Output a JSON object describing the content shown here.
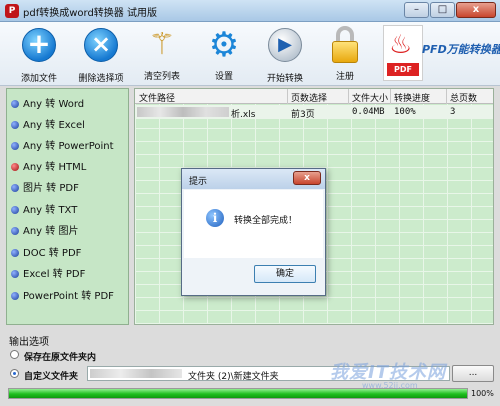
{
  "window": {
    "title": "pdf转换成word转换器 试用版",
    "icon_name": "app-icon",
    "minimize": "–",
    "maximize": "□",
    "close": "x"
  },
  "toolbar": {
    "add_file": "添加文件",
    "remove_selected": "删除选择项",
    "clear_list": "清空列表",
    "settings": "设置",
    "start_convert": "开始转换",
    "register": "注册",
    "pdf_logo_text": "PDF",
    "brand": "PFD万能转换器"
  },
  "left_menu": [
    {
      "label": "Any 转 Word",
      "icon": "blue-dot-icon"
    },
    {
      "label": "Any 转 Excel",
      "icon": "blue-dot-icon"
    },
    {
      "label": "Any 转 PowerPoint",
      "icon": "blue-dot-icon"
    },
    {
      "label": "Any 转 HTML",
      "icon": "red-dot-icon"
    },
    {
      "label": "图片 转 PDF",
      "icon": "blue-dot-icon"
    },
    {
      "label": "Any 转 TXT",
      "icon": "blue-dot-icon"
    },
    {
      "label": "Any 转 图片",
      "icon": "blue-dot-icon"
    },
    {
      "label": "DOC 转 PDF",
      "icon": "blue-dot-icon"
    },
    {
      "label": "Excel 转 PDF",
      "icon": "blue-dot-icon"
    },
    {
      "label": "PowerPoint 转 PDF",
      "icon": "blue-dot-icon"
    }
  ],
  "table": {
    "headers": [
      "文件路径",
      "页数选择",
      "文件大小",
      "转换进度",
      "总页数"
    ],
    "rows": [
      {
        "path_suffix": "析.xls",
        "pages": "前3页",
        "size": "0.04MB",
        "progress": "100%",
        "total": "3"
      }
    ]
  },
  "dialog": {
    "title": "提示",
    "close": "x",
    "message": "转换全部完成！",
    "ok": "确定",
    "icon": "info-icon"
  },
  "output": {
    "label": "输出选项",
    "option_original": "保存在原文件夹内",
    "option_custom": "自定义文件夹",
    "custom_path_suffix": "文件夹 (2)\\新建文件夹",
    "browse": "...",
    "selected": "custom"
  },
  "progress": {
    "value": 1.0,
    "label": "100%"
  },
  "watermark": {
    "text": "我爱IT技术网",
    "url": "www.52ij.com"
  }
}
